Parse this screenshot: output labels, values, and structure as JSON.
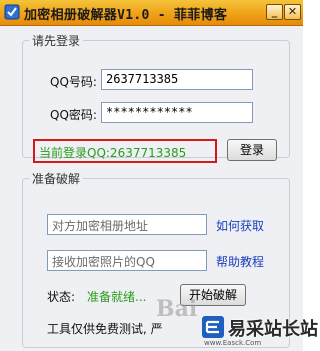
{
  "window": {
    "title": "加密相册破解器V1.0 - 菲菲博客",
    "minimize_glyph": "_",
    "close_glyph": "✕"
  },
  "login": {
    "legend": "请先登录",
    "qq_label": "QQ号码:",
    "qq_value": "2637713385",
    "pwd_label": "QQ密码:",
    "pwd_value": "************",
    "status": "当前登录QQ:2637713385",
    "login_button": "登录"
  },
  "crack": {
    "legend": "准备破解",
    "album_placeholder": "对方加密相册地址",
    "how_link": "如何获取",
    "receive_placeholder": "接收加密照片的QQ",
    "help_link": "帮助教程",
    "state_label": "状态:",
    "state_value": "准备就绪...",
    "start_button": "开始破解",
    "notice": "工具仅供免费测试, 严"
  },
  "watermark": {
    "text": "Bai",
    "site": "易采站长站",
    "url": "www.Easck.Com"
  },
  "colors": {
    "titlebar": "#ee9f16",
    "status_green": "#2a9c1c",
    "link_blue": "#1a3fbf",
    "highlight_red": "#d11b1b"
  }
}
